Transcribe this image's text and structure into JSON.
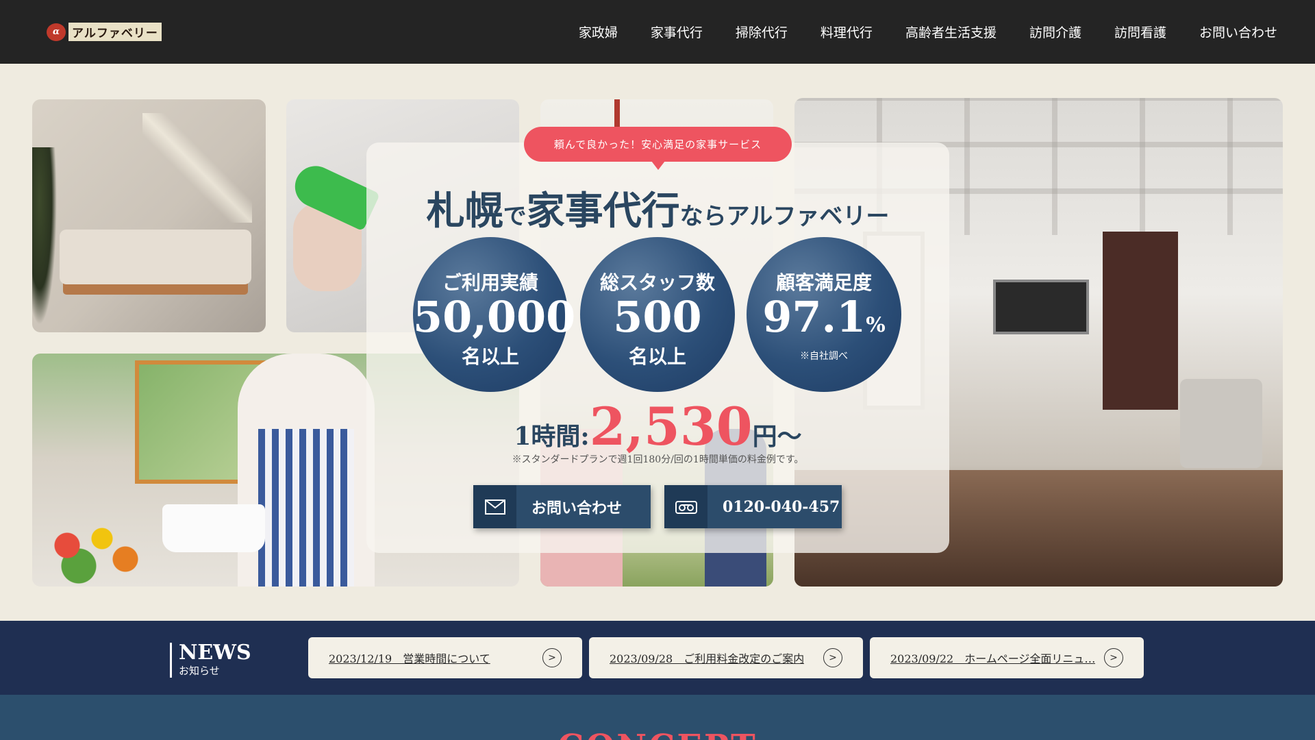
{
  "header": {
    "logo_mark": "α",
    "logo_text": "アルファベリー",
    "nav": [
      "家政婦",
      "家事代行",
      "掃除代行",
      "料理代行",
      "高齢者生活支援",
      "訪問介護",
      "訪問看護",
      "お問い合わせ"
    ]
  },
  "hero": {
    "bubble": "頼んで良かった！安心満足の家事サービス",
    "headline": {
      "part1": "札幌",
      "part2": "で",
      "part3": "家事代行",
      "part4": "ならアルファベリー"
    },
    "stats": [
      {
        "label": "ご利用実績",
        "value": "50,000",
        "suffix": "",
        "sub": "名以上"
      },
      {
        "label": "総スタッフ数",
        "value": "500",
        "suffix": "",
        "sub": "名以上"
      },
      {
        "label": "顧客満足度",
        "value": "97.1",
        "suffix": "%",
        "note": "※自社調べ"
      }
    ],
    "price": {
      "prefix": "1時間:",
      "value": "2,530",
      "unit": "円～",
      "note": "※スタンダードプランで週1回180分/回の1時間単価の料金例です。"
    },
    "buttons": {
      "contact": "お問い合わせ",
      "phone": "0120-040-457"
    }
  },
  "news": {
    "title": "NEWS",
    "subtitle": "お知らせ",
    "items": [
      {
        "text": "2023/12/19　営業時間について"
      },
      {
        "text": "2023/09/28　ご利用料金改定のご案内"
      },
      {
        "text": "2023/09/22　ホームページ全面リニュ…"
      }
    ]
  },
  "concept": {
    "title": "CONCEPT"
  },
  "colors": {
    "accent": "#ee5460",
    "navy": "#2c4f78",
    "header_bg": "#242424",
    "news_bg": "#1f2f52"
  },
  "icons": [
    "mail-icon",
    "phone-icon",
    "arrow-right-circle-icon"
  ]
}
